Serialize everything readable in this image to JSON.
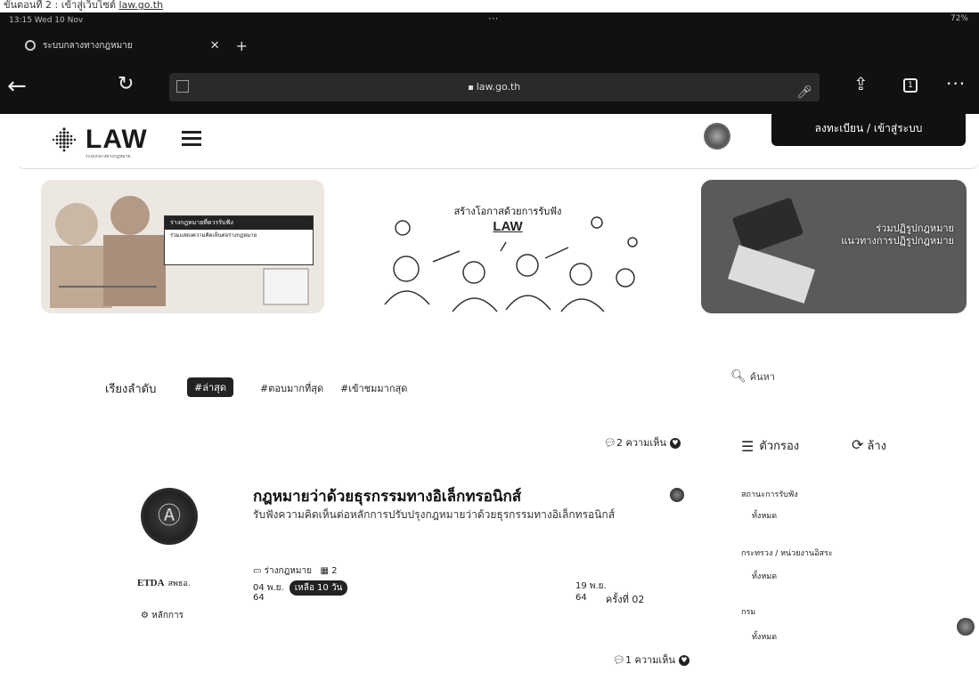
{
  "doc_caption": {
    "prefix": "ขั้นตอนที่ 2 : เข้าสู่เว็บไซต์",
    "link": "law.go.th"
  },
  "statusbar": {
    "time": "13:15  Wed 10 Nov",
    "battery": "72%"
  },
  "browser": {
    "tab_title": "ระบบกลางทางกฎหมาย",
    "url": "law.go.th",
    "icons": [
      "back-icon",
      "reload-icon",
      "share-icon",
      "tabs-icon",
      "more-icon",
      "mic-icon"
    ]
  },
  "site": {
    "logo_text": "LAW",
    "logo_sub": "ระบบกลางทางกฎหมาย",
    "login_label": "ลงทะเบียน / เข้าสู่ระบบ"
  },
  "banners": {
    "b1_card_title": "ร่างกฎหมายที่ควรรับฟัง",
    "b1_card_text": "ร่วมแสดงความคิดเห็นต่อร่างกฎหมาย",
    "b2_title": "สร้างโอกาสด้วยการรับฟัง",
    "b2_logo": "LAW",
    "b3_line1": "ร่วมปฏิรูปกฎหมาย",
    "b3_line2": "แนวทางการปฏิรูปกฎหมาย"
  },
  "sort": {
    "label": "เรียงลำดับ",
    "options": [
      "#ล่าสุด",
      "#ตอบมากที่สุด",
      "#เข้าชมมากสุด"
    ],
    "active_index": 0
  },
  "search": {
    "placeholder": "ค้นหา"
  },
  "filters": {
    "title": "ตัวกรอง",
    "clear": "ล้าง",
    "groups": [
      {
        "label": "สถานะการรับฟัง",
        "value": "ทั้งหมด"
      },
      {
        "label": "กระทรวง / หน่วยงานอิสระ",
        "value": "ทั้งหมด"
      },
      {
        "label": "กรม",
        "value": "ทั้งหมด"
      }
    ]
  },
  "items": [
    {
      "comments": "2 ความเห็น",
      "title": "กฎหมายว่าด้วยธุรกรรมทางอิเล็กทรอนิกส์",
      "description": "รับฟังความคิดเห็นต่อหลักการปรับปรุงกฎหมายว่าด้วยธุรกรรมทางอิเล็กทรอนิกส์",
      "agency": "ETDA",
      "agency_sub": "สพธอ.",
      "principle": "หลักการ",
      "type": "ร่างกฎหมาย",
      "file_count": "2",
      "start_date": "04 พ.ย.",
      "start_year": "64",
      "remaining": "เหลือ 10 วัน",
      "end_date": "19 พ.ย.",
      "end_year": "64",
      "round": "ครั้งที่ 02"
    }
  ],
  "next_item_comments": "1 ความเห็น"
}
